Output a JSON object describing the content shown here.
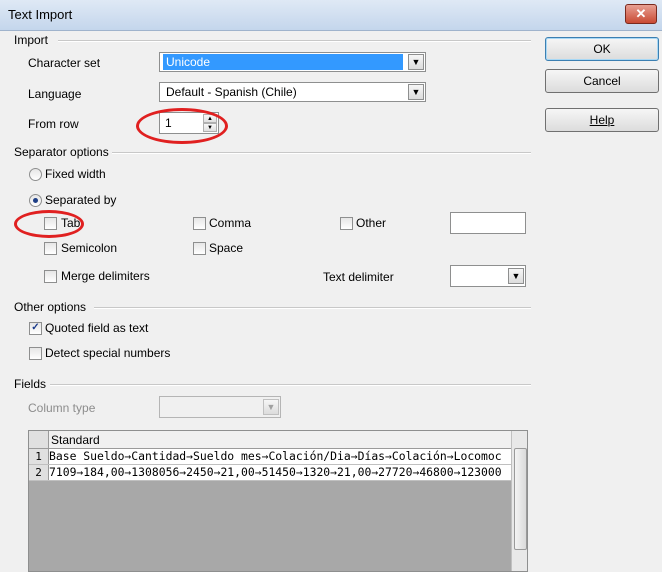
{
  "window": {
    "title": "Text Import",
    "close_glyph": "✕"
  },
  "import": {
    "heading": "Import",
    "charset_label": "Character set",
    "charset_value": "Unicode",
    "language_label": "Language",
    "language_value": "Default - Spanish (Chile)",
    "fromrow_label": "From row",
    "fromrow_value": "1"
  },
  "separator": {
    "heading": "Separator options",
    "fixed_width": "Fixed width",
    "separated_by": "Separated by",
    "tab": "Tab",
    "comma": "Comma",
    "other": "Other",
    "semicolon": "Semicolon",
    "space": "Space",
    "merge": "Merge delimiters",
    "text_delimiter": "Text delimiter"
  },
  "other_options": {
    "heading": "Other options",
    "quoted": "Quoted field as text",
    "detect": "Detect special numbers"
  },
  "fields": {
    "heading": "Fields",
    "column_type": "Column type",
    "column_header": "Standard",
    "rows": [
      {
        "num": "1",
        "text": "Base Sueldo→Cantidad→Sueldo mes→Colación/Dia→Días→Colación→Locomoc"
      },
      {
        "num": "2",
        "text": "7109→184,00→1308056→2450→21,00→51450→1320→21,00→27720→46800→123000"
      }
    ]
  },
  "buttons": {
    "ok": "OK",
    "cancel": "Cancel",
    "help": "Help"
  },
  "colors": {
    "highlight": "#3399ff",
    "annotation": "#e02020"
  }
}
